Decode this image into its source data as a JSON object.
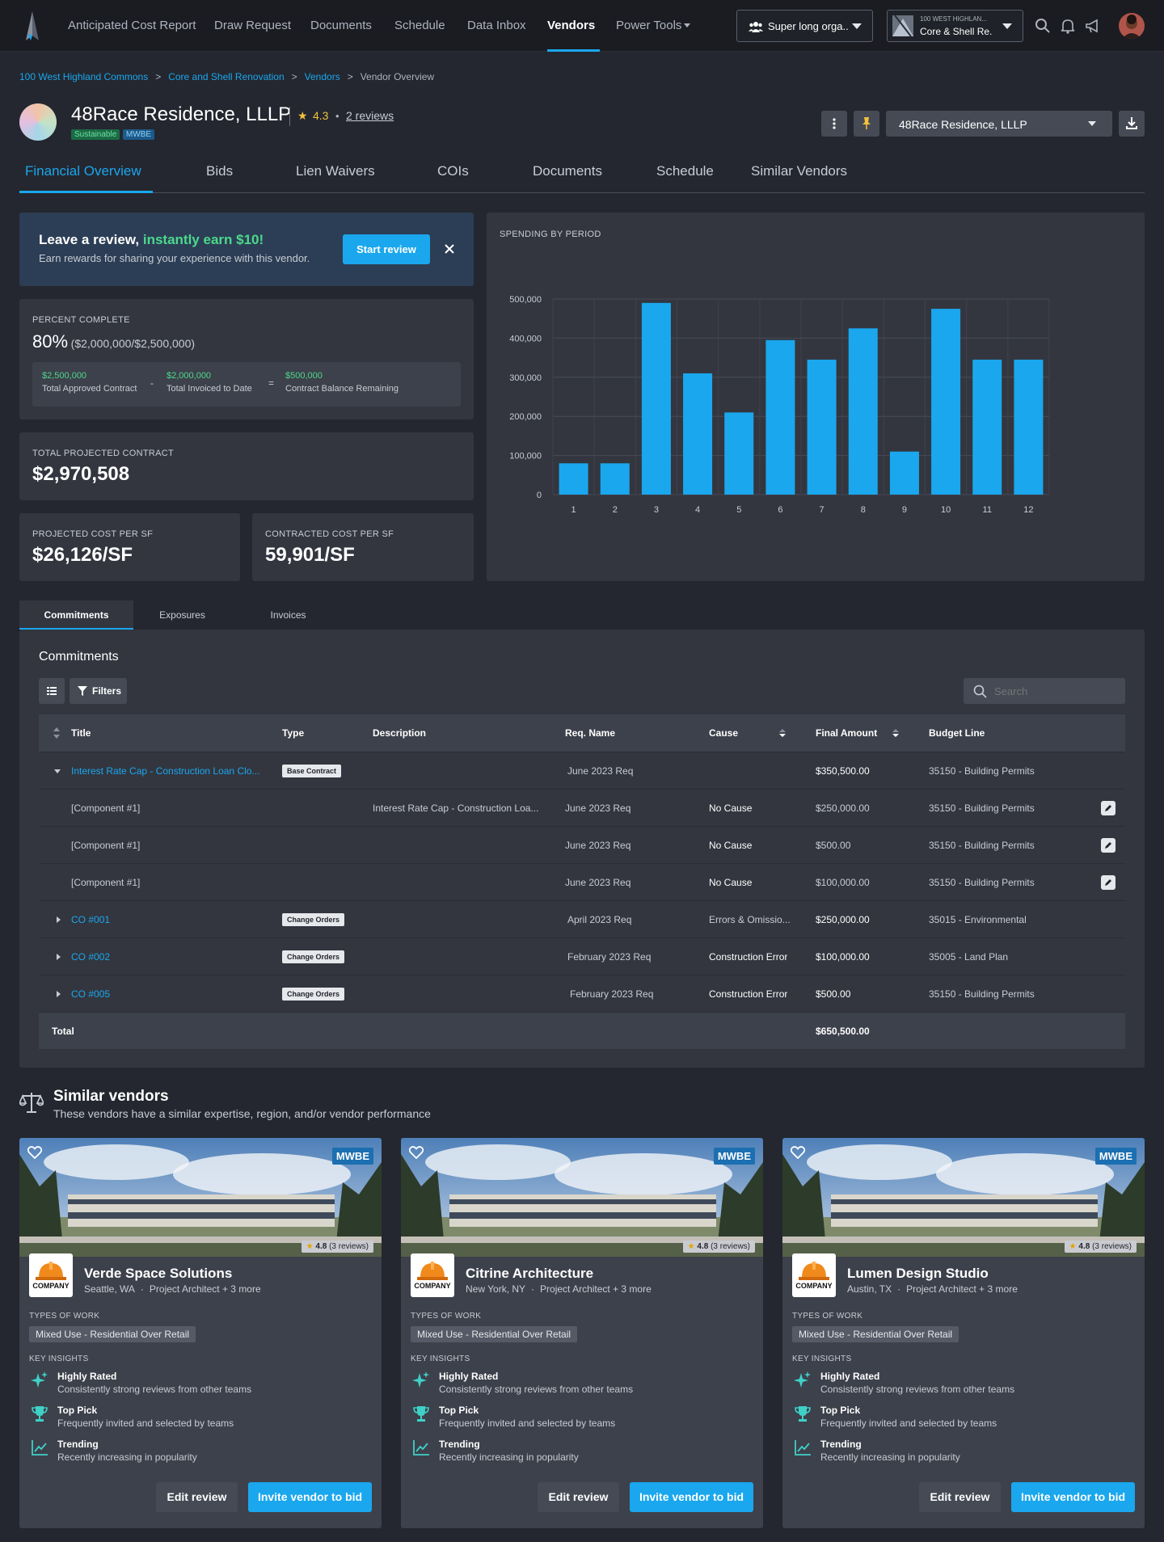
{
  "nav": {
    "items": [
      "Anticipated Cost Report",
      "Draw Request",
      "Documents",
      "Schedule",
      "Data Inbox",
      "Vendors",
      "Power Tools"
    ],
    "active": "Vendors",
    "org_selector": "Super long orga...",
    "project_selector_top": "100 WEST HIGHLAN...",
    "project_selector_bottom": "Core & Shell Re..."
  },
  "breadcrumb": [
    "100 West Highland Commons",
    "Core and Shell Renovation",
    "Vendors",
    "Vendor Overview"
  ],
  "vendor": {
    "name": "48Race Residence, LLLP",
    "badges": [
      "Sustainable",
      "MWBE"
    ],
    "rating": "4.3",
    "reviews": "2 reviews",
    "selector": "48Race Residence, LLLP"
  },
  "tabs": [
    "Financial Overview",
    "Bids",
    "Lien Waivers",
    "COIs",
    "Documents",
    "Schedule",
    "Similar Vendors"
  ],
  "review_banner": {
    "title": "Leave a review,",
    "highlight": "instantly earn $10!",
    "subtitle": "Earn rewards for sharing your experience with this vendor.",
    "button": "Start review"
  },
  "percent_complete": {
    "label": "PERCENT COMPLETE",
    "value": "80%",
    "detail": "($2,000,000/$2,500,000)",
    "approved_value": "$2,500,000",
    "approved_label": "Total Approved Contract",
    "minus": "-",
    "invoiced_value": "$2,000,000",
    "invoiced_label": "Total Invoiced to Date",
    "equals": "=",
    "balance_value": "$500,000",
    "balance_label": "Contract Balance Remaining"
  },
  "projected_contract": {
    "label": "TOTAL PROJECTED CONTRACT",
    "value": "$2,970,508"
  },
  "projected_cost_sf": {
    "label": "PROJECTED COST PER SF",
    "value": "$26,126/SF"
  },
  "contracted_cost_sf": {
    "label": "CONTRACTED COST PER SF",
    "value": "59,901/SF"
  },
  "chart_data": {
    "type": "bar",
    "title": "SPENDING BY PERIOD",
    "categories": [
      "1",
      "2",
      "3",
      "4",
      "5",
      "6",
      "7",
      "8",
      "9",
      "10",
      "11",
      "12"
    ],
    "values": [
      80000,
      80000,
      490000,
      310000,
      210000,
      395000,
      345000,
      425000,
      110000,
      475000,
      345000,
      345000
    ],
    "ylim": [
      0,
      500000
    ],
    "yticks": [
      "0",
      "100,000",
      "200,000",
      "300,000",
      "400,000",
      "500,000"
    ],
    "color": "#1aa7ee",
    "grid": true
  },
  "subtabs": [
    "Commitments",
    "Exposures",
    "Invoices"
  ],
  "commitments": {
    "title": "Commitments",
    "filters_label": "Filters",
    "search_placeholder": "Search",
    "columns": [
      "Title",
      "Type",
      "Description",
      "Req. Name",
      "Cause",
      "Final Amount",
      "Budget Line"
    ],
    "rows": [
      {
        "title": "Interest Rate Cap - Construction Loan Clo...",
        "type": "Base Contract",
        "description": "",
        "req": "June 2023 Req",
        "cause": "",
        "amount": "$350,500.00",
        "budget": "35150 - Building Permits"
      },
      {
        "title": "[Component  #1]",
        "type": "",
        "description": "Interest Rate Cap - Construction Loa...",
        "req": "June 2023 Req",
        "cause": "No Cause",
        "amount": "$250,000.00",
        "budget": "35150 - Building Permits"
      },
      {
        "title": "[Component  #1]",
        "type": "",
        "description": "",
        "req": "June 2023 Req",
        "cause": "No Cause",
        "amount": "$500.00",
        "budget": "35150 - Building Permits"
      },
      {
        "title": "[Component  #1]",
        "type": "",
        "description": "",
        "req": "June 2023 Req",
        "cause": "No Cause",
        "amount": "$100,000.00",
        "budget": "35150 - Building Permits"
      },
      {
        "title": "CO #001",
        "type": "Change Orders",
        "description": "",
        "req": "April 2023 Req",
        "cause": "Errors & Omissio...",
        "amount": "$250,000.00",
        "budget": "35015 - Environmental"
      },
      {
        "title": "CO #002",
        "type": "Change Orders",
        "description": "",
        "req": "February 2023 Req",
        "cause": "Construction Error",
        "amount": "$100,000.00",
        "budget": "35005 - Land Plan"
      },
      {
        "title": "CO #005",
        "type": "Change Orders",
        "description": "",
        "req": "February 2023 Req",
        "cause": "Construction Error",
        "amount": "$500.00",
        "budget": "35150 - Building Permits"
      }
    ],
    "total_label": "Total",
    "total_amount": "$650,500.00"
  },
  "similar": {
    "title": "Similar vendors",
    "subtitle": "These vendors have a similar expertise, region, and/or vendor performance",
    "types_label": "TYPES OF WORK",
    "insights_label": "KEY INSIGHTS",
    "logo_text": "COMPANY",
    "badge": "MWBE",
    "edit_label": "Edit review",
    "invite_label": "Invite vendor to bid",
    "vendors": [
      {
        "name": "Verde Space Solutions",
        "city": "Seattle, WA",
        "role": "Project Architect + 3 more",
        "rating": "4.8",
        "reviews": "(3 reviews)",
        "work": "Mixed Use - Residential Over Retail"
      },
      {
        "name": "Citrine Architecture",
        "city": "New York, NY",
        "role": "Project Architect + 3 more",
        "rating": "4.8",
        "reviews": "(3 reviews)",
        "work": "Mixed Use - Residential Over Retail"
      },
      {
        "name": "Lumen Design Studio",
        "city": "Austin, TX",
        "role": "Project Architect + 3 more",
        "rating": "4.8",
        "reviews": "(3 reviews)",
        "work": "Mixed Use - Residential Over Retail"
      }
    ],
    "insights": [
      {
        "title": "Highly Rated",
        "desc": "Consistently strong reviews from other teams"
      },
      {
        "title": "Top Pick",
        "desc": "Frequently invited and selected by teams"
      },
      {
        "title": "Trending",
        "desc": "Recently increasing in popularity"
      }
    ]
  }
}
